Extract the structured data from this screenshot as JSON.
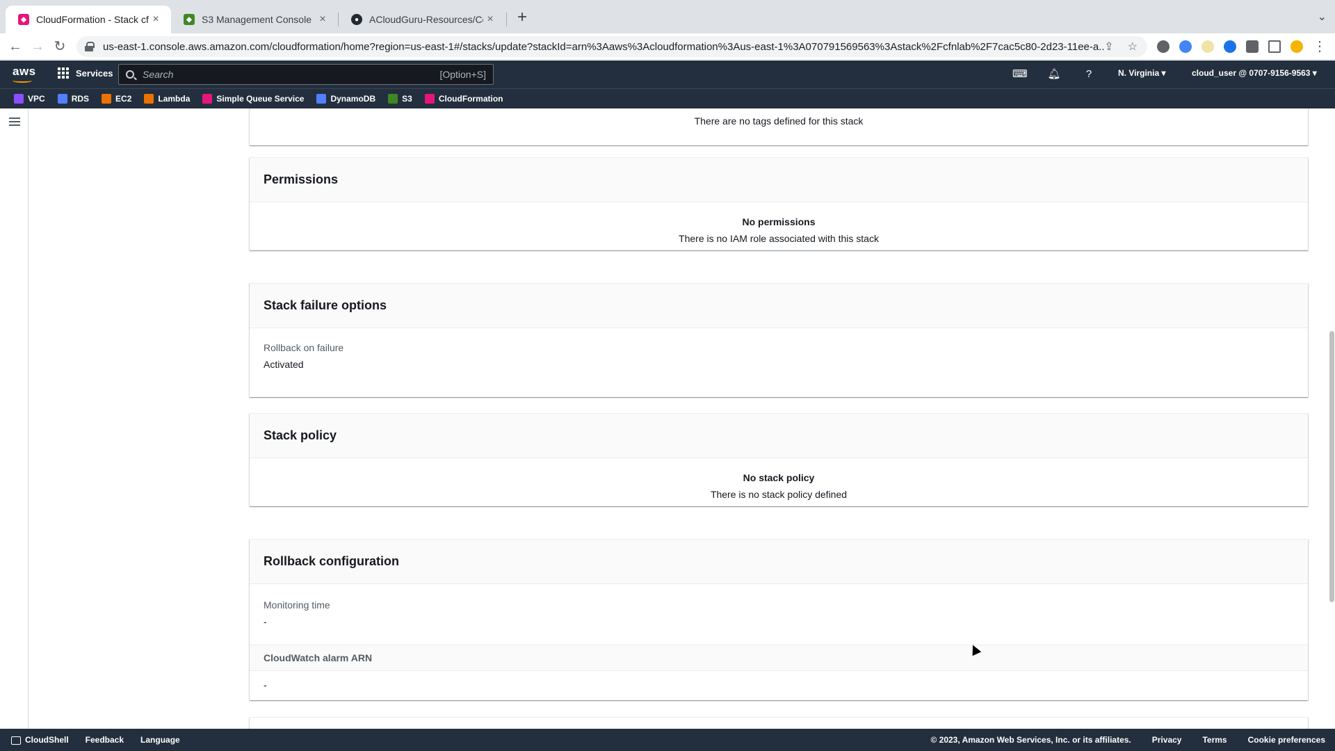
{
  "browser": {
    "tabs": [
      {
        "title": "CloudFormation - Stack cfnlab",
        "icon": "cloudformation-favicon",
        "color": "#e7157b",
        "active": true
      },
      {
        "title": "S3 Management Console",
        "icon": "s3-favicon",
        "color": "#3f8624",
        "active": false
      },
      {
        "title": "ACloudGuru-Resources/Cours",
        "icon": "github-favicon",
        "color": "#24292f",
        "active": false
      }
    ],
    "url": "us-east-1.console.aws.amazon.com/cloudformation/home?region=us-east-1#/stacks/update?stackId=arn%3Aaws%3Acloudformation%3Aus-east-1%3A070791569563%3Astack%2Fcfnlab%2F7cac5c80-2d23-11ee-a..."
  },
  "aws_header": {
    "logo": "aws",
    "services_label": "Services",
    "search_placeholder": "Search",
    "search_shortcut": "[Option+S]",
    "region": "N. Virginia ▾",
    "account": "cloud_user @ 0707-9156-9563 ▾"
  },
  "favorites": [
    {
      "label": "VPC",
      "color": "#8c4fff"
    },
    {
      "label": "RDS",
      "color": "#527fff"
    },
    {
      "label": "EC2",
      "color": "#ed7100"
    },
    {
      "label": "Lambda",
      "color": "#ed7100"
    },
    {
      "label": "Simple Queue Service",
      "color": "#e7157b"
    },
    {
      "label": "DynamoDB",
      "color": "#527fff"
    },
    {
      "label": "S3",
      "color": "#3f8624"
    },
    {
      "label": "CloudFormation",
      "color": "#e7157b"
    }
  ],
  "content": {
    "tags_empty": "There are no tags defined for this stack",
    "permissions": {
      "title": "Permissions",
      "empty_title": "No permissions",
      "empty_text": "There is no IAM role associated with this stack"
    },
    "failure_options": {
      "title": "Stack failure options",
      "label": "Rollback on failure",
      "value": "Activated"
    },
    "stack_policy": {
      "title": "Stack policy",
      "empty_title": "No stack policy",
      "empty_text": "There is no stack policy defined"
    },
    "rollback": {
      "title": "Rollback configuration",
      "monitoring_label": "Monitoring time",
      "monitoring_value": "-",
      "alarm_header": "CloudWatch alarm ARN",
      "alarm_value": "-"
    }
  },
  "footer": {
    "cloudshell": "CloudShell",
    "feedback": "Feedback",
    "language": "Language",
    "copyright": "© 2023, Amazon Web Services, Inc. or its affiliates.",
    "privacy": "Privacy",
    "terms": "Terms",
    "cookie": "Cookie preferences"
  }
}
